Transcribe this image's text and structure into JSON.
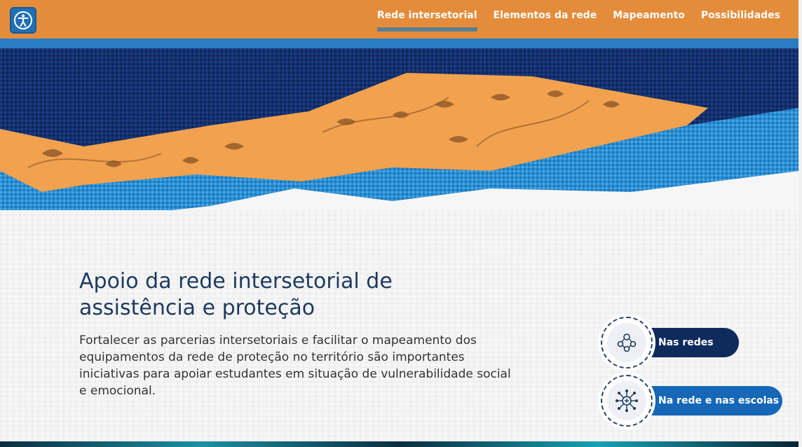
{
  "header": {
    "nav": [
      {
        "label": "Rede intersetorial",
        "active": true
      },
      {
        "label": "Elementos da rede",
        "active": false
      },
      {
        "label": "Mapeamento",
        "active": false
      },
      {
        "label": "Possibilidades",
        "active": false
      }
    ],
    "logo_icon": "accessibility-person-icon"
  },
  "main": {
    "title": "Apoio da rede intersetorial de assistência e proteção",
    "lead": "Fortalecer as parcerias intersetoriais e facilitar o mapeamento dos equipamentos da rede de proteção no território são importantes iniciativas para apoiar estudantes em situação de vulnerabilidade social e emocional."
  },
  "links": [
    {
      "label": "Nas redes",
      "icon": "people-network-icon"
    },
    {
      "label": "Na rede e nas escolas",
      "icon": "school-network-icon"
    }
  ],
  "colors": {
    "header": "#E58C3A",
    "title": "#1c3a5f",
    "dark_pill": "#0f2a5c",
    "blue_pill": "#1667b8"
  }
}
